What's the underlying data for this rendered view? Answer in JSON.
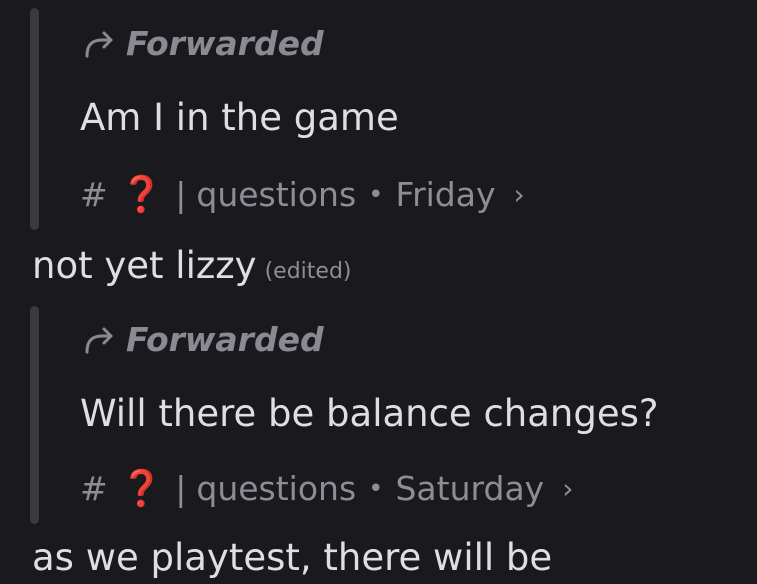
{
  "messages": [
    {
      "forwarded_label": "Forwarded",
      "text": "Am I in the game",
      "meta": {
        "hash": "#",
        "emoji": "❓",
        "pipe": "|",
        "channel": "questions",
        "dot": "•",
        "day": "Friday",
        "chevron": "›"
      },
      "reply": "not yet lizzy",
      "reply_edited": "(edited)"
    },
    {
      "forwarded_label": "Forwarded",
      "text": "Will there be balance changes?",
      "meta": {
        "hash": "#",
        "emoji": "❓",
        "pipe": "|",
        "channel": "questions",
        "dot": "•",
        "day": "Saturday",
        "chevron": "›"
      },
      "reply": "as we playtest, there will be"
    }
  ],
  "icons": {
    "forward": "forward-arrow-icon",
    "channel_link": "chevron-right-icon"
  },
  "colors": {
    "background": "#1a1a1e",
    "quote_bar": "#3a3a41",
    "text": "#dedee3",
    "muted": "#8d8d96",
    "emoji_red": "#d8262e"
  }
}
